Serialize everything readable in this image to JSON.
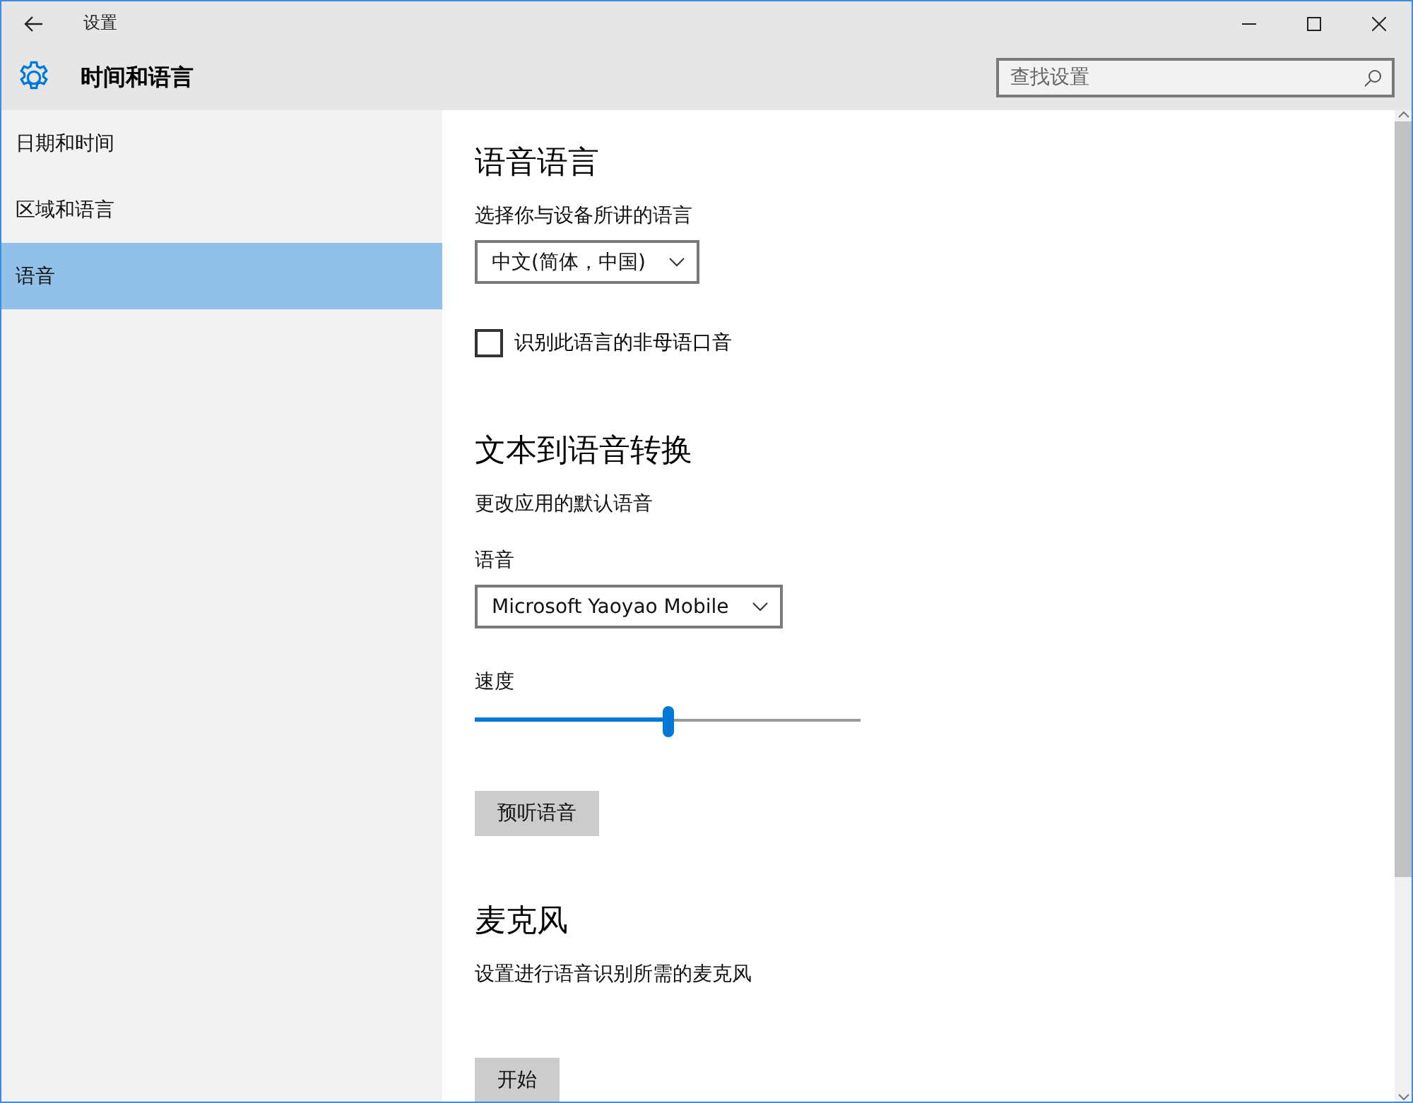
{
  "window": {
    "title": "设置"
  },
  "header": {
    "title": "时间和语言"
  },
  "search": {
    "placeholder": "查找设置"
  },
  "sidebar": {
    "items": [
      {
        "label": "日期和时间",
        "selected": false
      },
      {
        "label": "区域和语言",
        "selected": false
      },
      {
        "label": "语音",
        "selected": true
      }
    ]
  },
  "sections": [
    {
      "title": "语音语言",
      "items": [
        {
          "kind": "dropdown",
          "label": "选择你与设备所讲的语言",
          "value": "中文(简体，中国)"
        },
        {
          "kind": "checkbox",
          "label": "识别此语言的非母语口音",
          "checked": false
        }
      ]
    },
    {
      "title": "文本到语音转换",
      "items": [
        {
          "kind": "text",
          "label": "更改应用的默认语音"
        },
        {
          "kind": "dropdown",
          "label": "语音",
          "value": "Microsoft Yaoyao Mobile"
        },
        {
          "kind": "slider",
          "label": "速度",
          "level": 0.5
        },
        {
          "kind": "button",
          "label": "预听语音"
        }
      ]
    },
    {
      "title": "麦克风",
      "items": [
        {
          "kind": "text",
          "label": "设置进行语音识别所需的麦克风"
        },
        {
          "kind": "button",
          "label": "开始"
        }
      ]
    }
  ]
}
